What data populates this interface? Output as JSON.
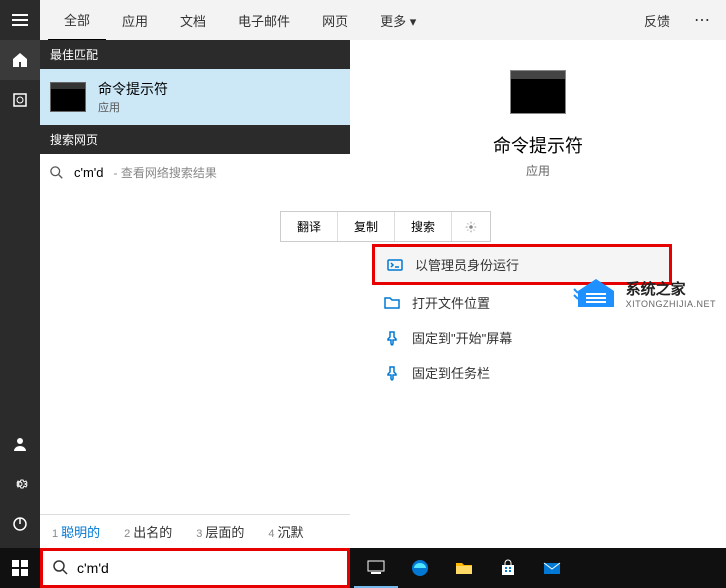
{
  "tabs": {
    "all": "全部",
    "apps": "应用",
    "docs": "文档",
    "email": "电子邮件",
    "web": "网页",
    "more": "更多"
  },
  "feedback": "反馈",
  "sections": {
    "bestMatch": "最佳匹配",
    "searchWeb": "搜索网页"
  },
  "bestMatch": {
    "title": "命令提示符",
    "subtitle": "应用"
  },
  "webSearch": {
    "query": "c'm'd",
    "hint": " - 查看网络搜索结果"
  },
  "suggestions": [
    {
      "num": "1",
      "label": "聪明的"
    },
    {
      "num": "2",
      "label": "出名的"
    },
    {
      "num": "3",
      "label": "层面的"
    },
    {
      "num": "4",
      "label": "沉默"
    }
  ],
  "preview": {
    "title": "命令提示符",
    "subtitle": "应用"
  },
  "contextBar": {
    "translate": "翻译",
    "copy": "复制",
    "search": "搜索"
  },
  "actions": {
    "runAsAdmin": "以管理员身份运行",
    "openLocation": "打开文件位置",
    "pinStart": "固定到\"开始\"屏幕",
    "pinTaskbar": "固定到任务栏"
  },
  "watermark": {
    "zh": "系统之家",
    "en": "XITONGZHIJIA.NET"
  },
  "searchInput": "c'm'd"
}
